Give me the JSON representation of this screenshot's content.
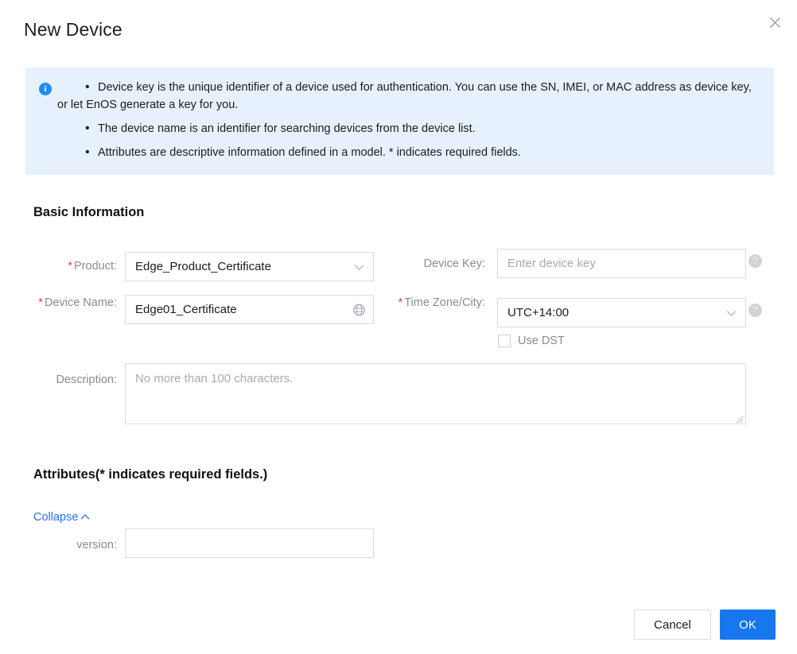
{
  "dialog": {
    "title": "New Device",
    "close_icon": "close-icon"
  },
  "info_banner": {
    "icon": "info-circle-icon",
    "items": [
      "Device key is the unique identifier of a device used for authentication. You can use the SN, IMEI, or MAC address as device key, or let EnOS generate a key for you.",
      "The device name is an identifier for searching devices from the device list.",
      "Attributes are descriptive information defined in a model. * indicates required fields."
    ]
  },
  "basic_information": {
    "heading": "Basic Information",
    "product": {
      "label": "Product:",
      "required_marker": "*",
      "value": "Edge_Product_Certificate",
      "caret_icon": "chevron-down-icon"
    },
    "device_name": {
      "label": "Device Name:",
      "required_marker": "*",
      "value": "Edge01_Certificate",
      "icon": "globe-translate-icon"
    },
    "device_key": {
      "label": "Device Key:",
      "value": "",
      "placeholder": "Enter device key",
      "help_icon": "question-circle-icon",
      "help_glyph": "?"
    },
    "time_zone": {
      "label": "Time Zone/City:",
      "required_marker": "*",
      "value": "UTC+14:00",
      "caret_icon": "chevron-down-icon",
      "help_icon": "question-circle-icon",
      "help_glyph": "?"
    },
    "use_dst": {
      "label": "Use DST",
      "checked": false
    },
    "description": {
      "label": "Description:",
      "value": "",
      "placeholder": "No more than 100 characters."
    }
  },
  "attributes": {
    "heading": "Attributes(* indicates required fields.)",
    "collapse": {
      "label": "Collapse",
      "caret_icon": "chevron-up-icon"
    },
    "version": {
      "label": "version:",
      "value": "",
      "placeholder": ""
    }
  },
  "footer": {
    "cancel_label": "Cancel",
    "ok_label": "OK"
  },
  "colors": {
    "primary": "#1677ee",
    "link": "#2a6ff5",
    "info_bg": "#e7f1fd",
    "info_icon": "#1f8cf9",
    "required": "#e03a3a",
    "label": "#8a8a94",
    "border": "#dcdcdc"
  }
}
